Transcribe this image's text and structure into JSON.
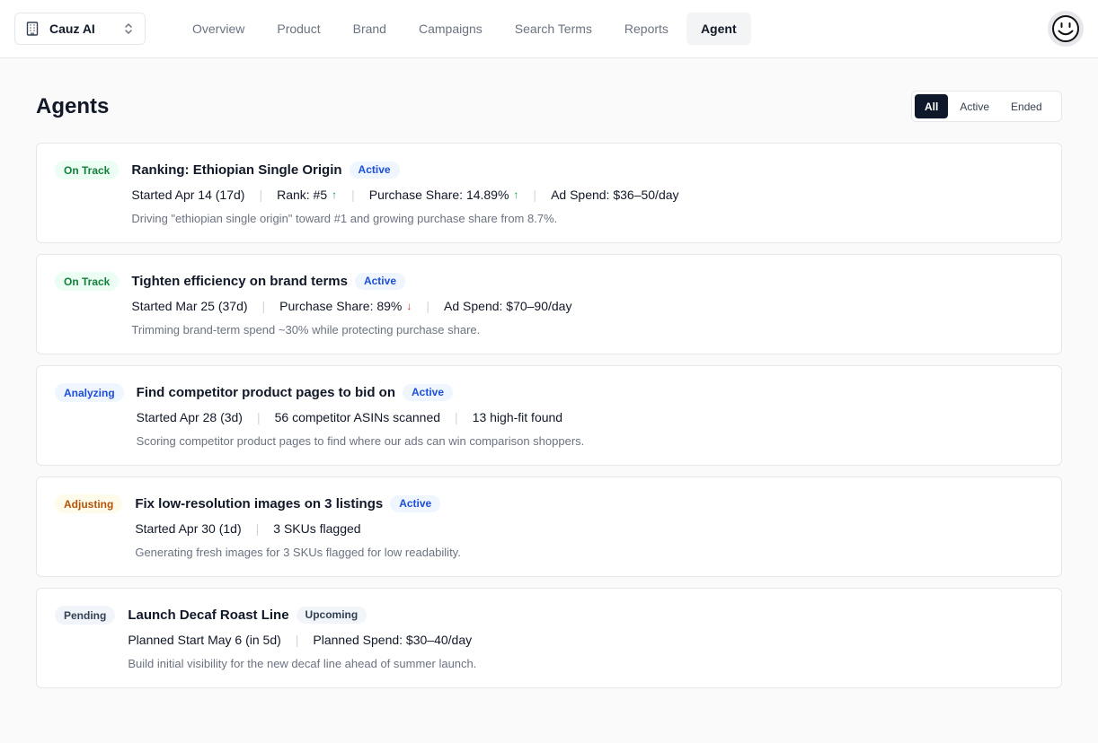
{
  "org": {
    "name": "Cauz AI"
  },
  "nav": {
    "items": [
      {
        "label": "Overview",
        "active": false
      },
      {
        "label": "Product",
        "active": false
      },
      {
        "label": "Brand",
        "active": false
      },
      {
        "label": "Campaigns",
        "active": false
      },
      {
        "label": "Search Terms",
        "active": false
      },
      {
        "label": "Reports",
        "active": false
      },
      {
        "label": "Agent",
        "active": true
      }
    ]
  },
  "page": {
    "title": "Agents"
  },
  "filter": {
    "options": [
      "All",
      "Active",
      "Ended"
    ],
    "selected": "All"
  },
  "agents": [
    {
      "status": "On Track",
      "title": "Ranking: Ethiopian Single Origin",
      "state": "Active",
      "meta": [
        {
          "text": "Started Apr 14 (17d)"
        },
        {
          "text": "Rank: #5",
          "arrow": "↑",
          "trend": "up"
        },
        {
          "text": "Purchase Share: 14.89%",
          "arrow": "↑",
          "trend": "up"
        },
        {
          "text": "Ad Spend: $36–50/day"
        }
      ],
      "description": "Driving \"ethiopian single origin\" toward #1 and growing purchase share from 8.7%."
    },
    {
      "status": "On Track",
      "title": "Tighten efficiency on brand terms",
      "state": "Active",
      "meta": [
        {
          "text": "Started Mar 25 (37d)"
        },
        {
          "text": "Purchase Share: 89%",
          "arrow": "↓",
          "trend": "down"
        },
        {
          "text": "Ad Spend: $70–90/day"
        }
      ],
      "description": "Trimming brand-term spend ~30% while protecting purchase share."
    },
    {
      "status": "Analyzing",
      "title": "Find competitor product pages to bid on",
      "state": "Active",
      "meta": [
        {
          "text": "Started Apr 28 (3d)"
        },
        {
          "text": "56 competitor ASINs scanned"
        },
        {
          "text": "13 high-fit found"
        }
      ],
      "description": "Scoring competitor product pages to find where our ads can win comparison shoppers."
    },
    {
      "status": "Adjusting",
      "title": "Fix low-resolution images on 3 listings",
      "state": "Active",
      "meta": [
        {
          "text": "Started Apr 30 (1d)"
        },
        {
          "text": "3 SKUs flagged"
        }
      ],
      "description": "Generating fresh images for 3 SKUs flagged for low readability."
    },
    {
      "status": "Pending",
      "title": "Launch Decaf Roast Line",
      "state": "Upcoming",
      "meta": [
        {
          "text": "Planned Start May 6 (in 5d)"
        },
        {
          "text": "Planned Spend: $30–40/day"
        }
      ],
      "description": "Build initial visibility for the new decaf line ahead of summer launch."
    }
  ]
}
